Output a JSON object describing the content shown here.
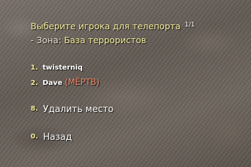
{
  "menu": {
    "title": "Выберите игрока для телепорта",
    "page": "1/1",
    "zone_label": "- Зона:",
    "zone_value": "База террористов",
    "players": [
      {
        "num": "1.",
        "name": "twisterniq",
        "status": ""
      },
      {
        "num": "2.",
        "name": "Dave",
        "status": "(МЁРТВ)"
      }
    ],
    "delete_item": {
      "num": "8.",
      "label": "Удалить место"
    },
    "back_item": {
      "num": "0.",
      "label": "Назад"
    }
  },
  "colors": {
    "title": "#f2ec9a",
    "number": "#f2ec9a",
    "text": "#ffffff",
    "dead_status": "#ef8a6e"
  }
}
